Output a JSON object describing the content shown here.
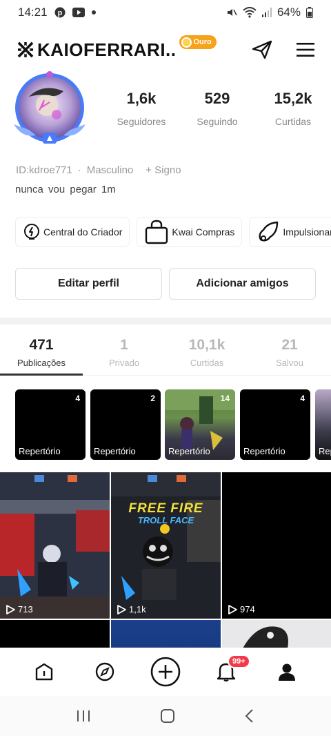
{
  "status_bar": {
    "time": "14:21",
    "battery": "64%",
    "icons": [
      "pinterest-icon",
      "youtube-icon",
      "dot-icon",
      "mute-icon",
      "wifi-icon",
      "signal-icon",
      "battery-icon"
    ]
  },
  "header": {
    "username": "KAIOFERRARI..",
    "username_prefix_icon": "x-mark-icon",
    "level_badge": "Ouro",
    "share_icon": "share-icon",
    "menu_icon": "menu-icon"
  },
  "profile": {
    "stats": [
      {
        "value": "1,6k",
        "label": "Seguidores"
      },
      {
        "value": "529",
        "label": "Seguindo"
      },
      {
        "value": "15,2k",
        "label": "Curtidas"
      }
    ],
    "id_text": "ID:kdroe771",
    "separator": "·",
    "gender": "Masculino",
    "sign": "+ Signo",
    "bio": "nunca vou pegar 1m"
  },
  "quick_actions": [
    {
      "label": "Central do Criador",
      "icon": "lightbulb-icon"
    },
    {
      "label": "Kwai Compras",
      "icon": "shopping-bag-icon"
    },
    {
      "label": "Impulsionar",
      "icon": "boost-icon"
    }
  ],
  "actions": {
    "edit": "Editar perfil",
    "add_friends": "Adicionar amigos"
  },
  "tabs": [
    {
      "count": "471",
      "label": "Publicações",
      "active": true
    },
    {
      "count": "1",
      "label": "Privado",
      "active": false
    },
    {
      "count": "10,1k",
      "label": "Curtidas",
      "active": false
    },
    {
      "count": "21",
      "label": "Salvou",
      "active": false
    }
  ],
  "playlists": [
    {
      "count": "4",
      "label": "Repertório"
    },
    {
      "count": "2",
      "label": "Repertório"
    },
    {
      "count": "14",
      "label": "Repertório"
    },
    {
      "count": "4",
      "label": "Repertório"
    },
    {
      "count": "",
      "label": "Rep"
    }
  ],
  "videos": [
    {
      "views": "713"
    },
    {
      "views": "1,1k",
      "overlay_title": "FREE FIRE",
      "overlay_subtitle": "TROLL FACE"
    },
    {
      "views": "974"
    }
  ],
  "bottom_nav": {
    "items": [
      "home-icon",
      "discover-icon",
      "create-icon",
      "notifications-icon",
      "profile-icon"
    ],
    "notif_badge": "99+"
  },
  "colors": {
    "badge_gold": "#f7a21b",
    "notif_red": "#f43a4a",
    "avatar_ring": "#4a7bf7"
  }
}
